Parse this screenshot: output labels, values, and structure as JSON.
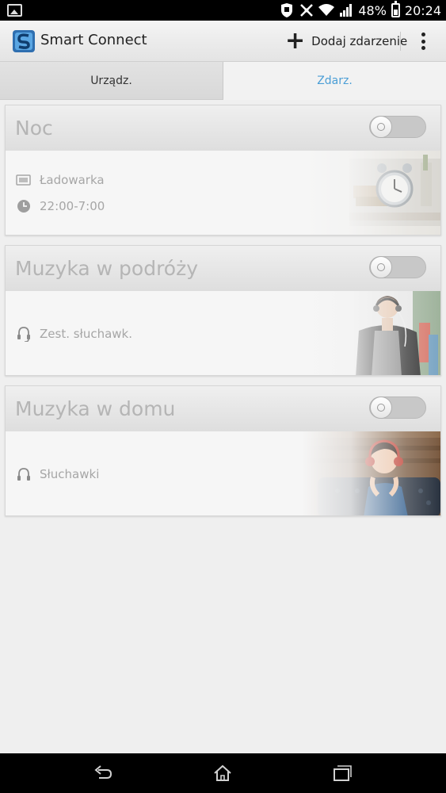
{
  "status_bar": {
    "battery_percent": "48%",
    "time": "20:24",
    "battery_level": 0.48
  },
  "app": {
    "title": "Smart Connect",
    "icon": "smart-connect-logo"
  },
  "action_bar": {
    "add_event_label": "Dodaj zdarzenie",
    "add_icon": "plus-icon",
    "overflow_icon": "more-vert-icon"
  },
  "tabs": [
    {
      "label": "Urządz.",
      "selected": false
    },
    {
      "label": "Zdarz.",
      "selected": true
    }
  ],
  "events": [
    {
      "title": "Noc",
      "enabled": false,
      "rows": [
        {
          "icon": "charger-icon",
          "text": "Ładowarka"
        },
        {
          "icon": "clock-icon",
          "text": "22:00-7:00"
        }
      ],
      "image": "alarm-clock-photo"
    },
    {
      "title": "Muzyka w podróży",
      "enabled": false,
      "rows": [
        {
          "icon": "headset-icon",
          "text": "Zest. słuchawk."
        }
      ],
      "image": "man-with-headphones-photo"
    },
    {
      "title": "Muzyka w domu",
      "enabled": false,
      "rows": [
        {
          "icon": "headphones-icon",
          "text": "Słuchawki"
        }
      ],
      "image": "woman-with-headphones-photo"
    }
  ],
  "nav_bar": {
    "back_icon": "back-icon",
    "home_icon": "home-icon",
    "recents_icon": "recents-icon"
  },
  "colors": {
    "accent": "#4a9ed6",
    "status_bar": "#000000",
    "card_title": "#b5b5b5"
  }
}
